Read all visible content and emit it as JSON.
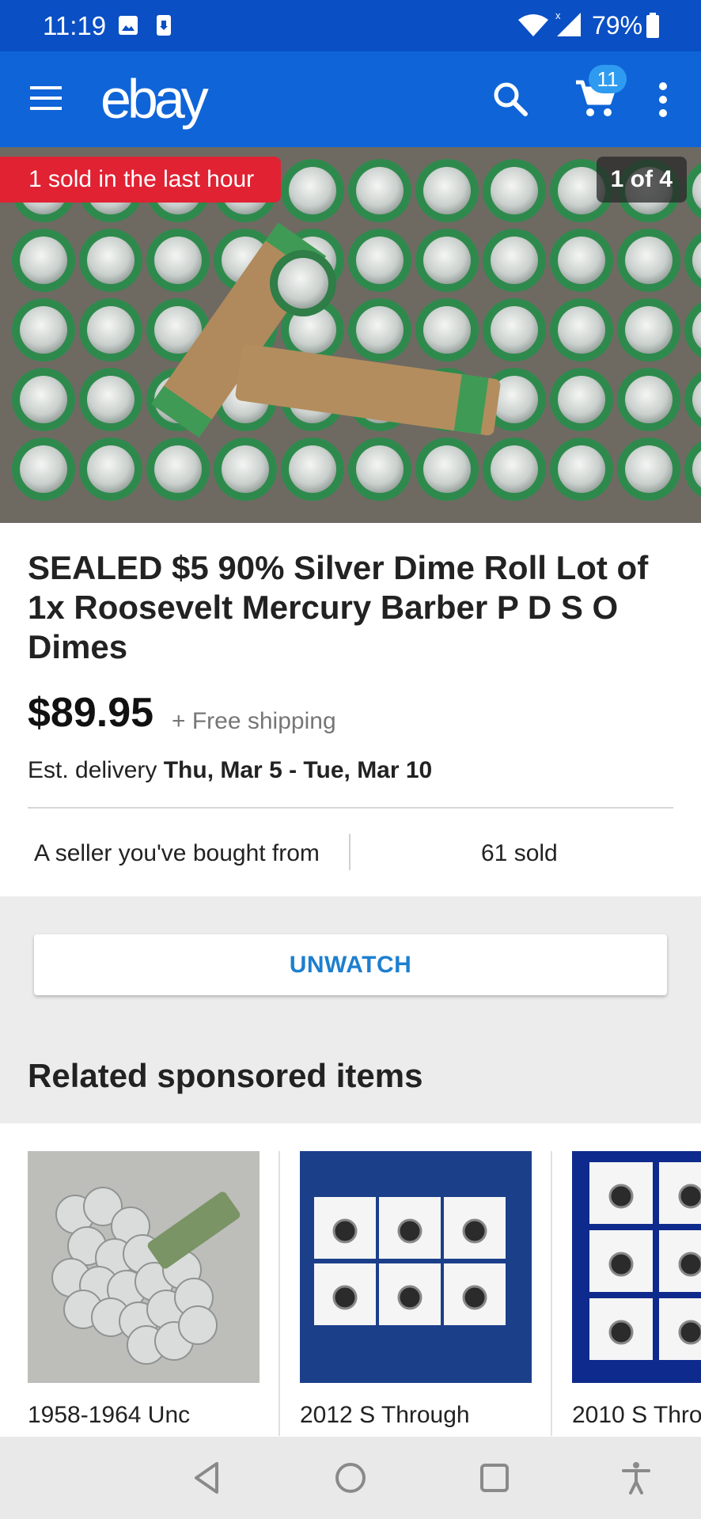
{
  "status_bar": {
    "time": "11:19",
    "battery": "79%"
  },
  "app_bar": {
    "logo": "ebay",
    "cart_count": "11"
  },
  "hero": {
    "sold_banner": "1 sold in the last hour",
    "image_counter": "1 of 4"
  },
  "item": {
    "title": "SEALED $5 90% Silver Dime Roll Lot of 1x Roosevelt Mercury Barber P D S O Dimes",
    "price": "$89.95",
    "shipping": "+ Free shipping",
    "delivery_label": "Est. delivery ",
    "delivery_dates": "Thu, Mar 5 - Tue, Mar 10",
    "seller_note": "A seller you've bought from",
    "sold_count": "61 sold"
  },
  "watch_button": "UNWATCH",
  "related": {
    "heading": "Related sponsored items",
    "items": [
      {
        "title": "1958-1964 Unc"
      },
      {
        "title": "2012 S Through"
      },
      {
        "title": "2010 S Thro"
      }
    ]
  },
  "colors": {
    "brand_blue": "#0f64d8",
    "status_blue": "#0a4fc4",
    "alert_red": "#e02233",
    "link_blue": "#1d7fcf"
  }
}
